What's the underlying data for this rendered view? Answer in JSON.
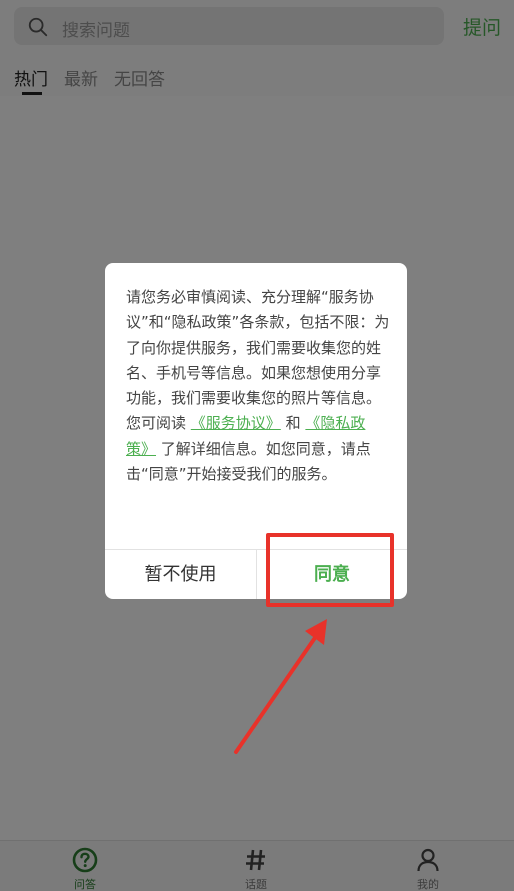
{
  "header": {
    "search_placeholder": "搜索问题",
    "ask_label": "提问"
  },
  "tabs": [
    {
      "label": "热门",
      "active": true
    },
    {
      "label": "最新",
      "active": false
    },
    {
      "label": "无回答",
      "active": false
    }
  ],
  "dialog": {
    "text_part1": "请您务必审慎阅读、充分理解“服务协议”和“隐私政策”各条款，包括不限：为了向你提供服务，我们需要收集您的姓名、手机号等信息。如果您想使用分享功能，我们需要收集您的照片等信息。",
    "text_part2_prefix": "您可阅读",
    "link_service": "《服务协议》",
    "text_and": "和",
    "link_privacy": "《隐私政策》",
    "text_part2_suffix": "了解详细信息。如您同意，请点击“同意”开始接受我们的服务。",
    "decline_label": "暂不使用",
    "agree_label": "同意"
  },
  "bottom_nav": [
    {
      "label": "问答",
      "icon": "question-circle-icon",
      "active": true
    },
    {
      "label": "话题",
      "icon": "hashtag-icon",
      "active": false
    },
    {
      "label": "我的",
      "icon": "user-icon",
      "active": false
    }
  ],
  "colors": {
    "accent": "#4caf50",
    "highlight": "#e8322a"
  }
}
